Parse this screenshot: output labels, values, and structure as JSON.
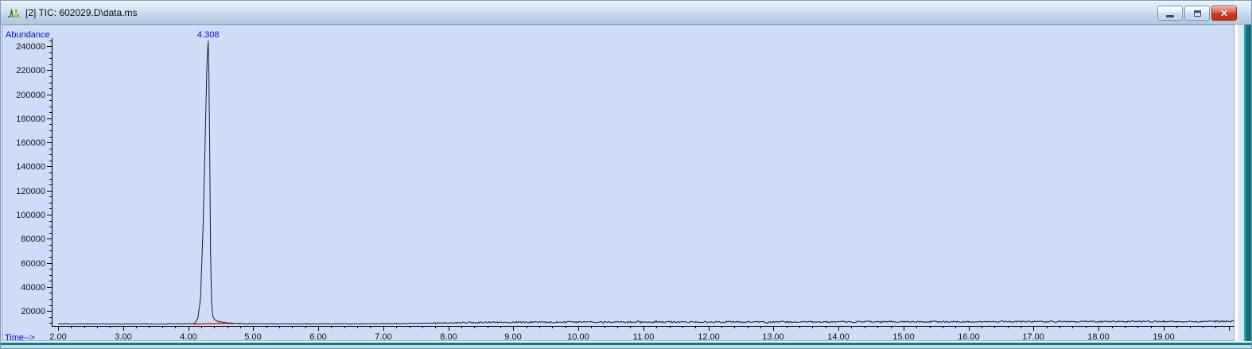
{
  "window": {
    "title": "[2] TIC: 602029.D\\data.ms",
    "icon": "chromatogram-icon",
    "controls": {
      "minimize": "minimize",
      "maximize": "maximize",
      "close": "close"
    }
  },
  "chart_data": {
    "type": "line",
    "title": "",
    "ylabel": "Abundance",
    "xlabel": "Time-->",
    "xlim": [
      2.0,
      20.1
    ],
    "ylim": [
      7500,
      248000
    ],
    "x_ticks": {
      "values": [
        2,
        3,
        4,
        5,
        6,
        7,
        8,
        9,
        10,
        11,
        12,
        13,
        14,
        15,
        16,
        17,
        18,
        19,
        20
      ],
      "labels": [
        "2.00",
        "3.00",
        "4.00",
        "5.00",
        "6.00",
        "7.00",
        "8.00",
        "9.00",
        "10.00",
        "11.00",
        "12.00",
        "13.00",
        "14.00",
        "15.00",
        "16.00",
        "17.00",
        "18.00",
        "19.00",
        ""
      ]
    },
    "x_minor_step": 0.2,
    "y_ticks": {
      "values": [
        20000,
        40000,
        60000,
        80000,
        100000,
        120000,
        140000,
        160000,
        180000,
        200000,
        220000,
        240000
      ],
      "labels": [
        "20000",
        "40000",
        "60000",
        "80000",
        "100000",
        "120000",
        "140000",
        "160000",
        "180000",
        "200000",
        "220000",
        "240000"
      ]
    },
    "y_minor_step": 5000,
    "peaks": [
      {
        "rt": 4.308,
        "label": "4.308",
        "apex_abundance": 244500
      }
    ],
    "integration_baseline": {
      "from": [
        4.08,
        9000
      ],
      "to": [
        4.7,
        9800
      ],
      "color": "#dd1111"
    },
    "series": [
      {
        "name": "TIC",
        "keypoints": [
          [
            2.0,
            9200
          ],
          [
            3.0,
            9150
          ],
          [
            3.8,
            9200
          ],
          [
            4.05,
            9300
          ],
          [
            4.1,
            9800
          ],
          [
            4.15,
            14000
          ],
          [
            4.19,
            30000
          ],
          [
            4.23,
            90000
          ],
          [
            4.265,
            170000
          ],
          [
            4.29,
            225000
          ],
          [
            4.308,
            244500
          ],
          [
            4.32,
            215000
          ],
          [
            4.332,
            150000
          ],
          [
            4.345,
            70000
          ],
          [
            4.36,
            28000
          ],
          [
            4.38,
            15500
          ],
          [
            4.41,
            12500
          ],
          [
            4.47,
            11000
          ],
          [
            4.55,
            10300
          ],
          [
            4.65,
            9800
          ],
          [
            4.8,
            9400
          ],
          [
            5.5,
            9200
          ],
          [
            6.5,
            9250
          ],
          [
            7.2,
            9400
          ],
          [
            7.8,
            9900
          ],
          [
            8.3,
            10300
          ],
          [
            9.0,
            10600
          ],
          [
            10.0,
            10700
          ],
          [
            11.0,
            10700
          ],
          [
            12.0,
            10800
          ],
          [
            13.0,
            10800
          ],
          [
            14.0,
            10900
          ],
          [
            15.0,
            11000
          ],
          [
            16.0,
            11000
          ],
          [
            17.0,
            11100
          ],
          [
            18.0,
            11200
          ],
          [
            19.0,
            11200
          ],
          [
            20.08,
            11400
          ]
        ]
      }
    ],
    "noise": {
      "amp_before": 300,
      "amp_after": 620,
      "change_at": 7.8,
      "quiet_zone": [
        4.05,
        4.44
      ]
    },
    "trace_color": "#1a1a1a",
    "axis_color": "#000000",
    "label_color": "#0a0ad0",
    "tick_label_color": "#101010",
    "legend_position": "none",
    "grid": false
  },
  "colors": {
    "plot_background": "#cfdcf8",
    "titlebar_gradient_top": "#e8f3fc",
    "titlebar_gradient_bottom": "#b2c9e2",
    "frame_teal": "#0b717b",
    "close_button_red": "#c23318"
  }
}
